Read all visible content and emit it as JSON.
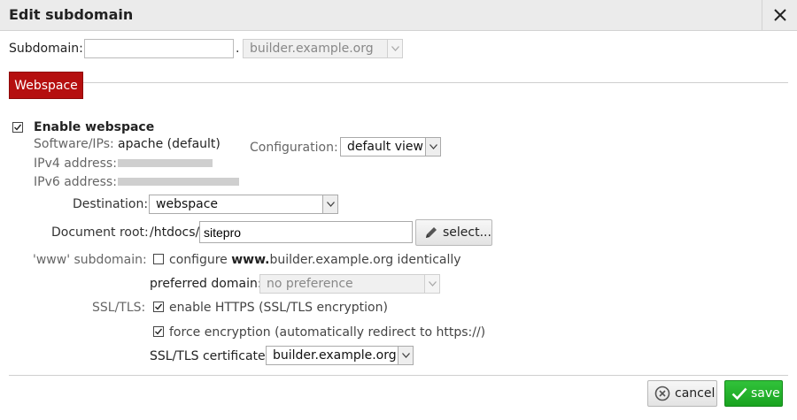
{
  "dialog": {
    "title": "Edit subdomain"
  },
  "subdomain": {
    "label": "Subdomain:",
    "value": "",
    "separator": ".",
    "domain_selected": "builder.example.org"
  },
  "tabs": [
    {
      "label": "Webspace",
      "color": "#b50f0f"
    }
  ],
  "webspace": {
    "enable_label": "Enable webspace",
    "enable_checked": true,
    "software_label": "Software/IPs:",
    "software_value": "apache (default)",
    "ipv4_label": "IPv4 address:",
    "ipv6_label": "IPv6 address:",
    "configuration_label": "Configuration:",
    "configuration_value": "default view",
    "destination_label": "Destination:",
    "destination_value": "webspace",
    "docroot_label": "Document root:",
    "docroot_prefix": "/htdocs/",
    "docroot_value": "sitepro",
    "select_button": "select...",
    "www_label": "'www' subdomain:",
    "www_checked": false,
    "www_text_prefix": "configure ",
    "www_text_bold": "www.",
    "www_text_suffix": "builder.example.org identically",
    "preferred_label": "preferred domain:",
    "preferred_value": "no preference",
    "ssl_label": "SSL/TLS:",
    "https_checked": true,
    "https_text": "enable HTTPS (SSL/TLS encryption)",
    "force_checked": true,
    "force_text": "force encryption (automatically redirect to https://)",
    "cert_label": "SSL/TLS certificate:",
    "cert_value": "builder.example.org"
  },
  "footer": {
    "cancel_label": "cancel",
    "save_label": "save",
    "save_color": "#1fae27"
  }
}
